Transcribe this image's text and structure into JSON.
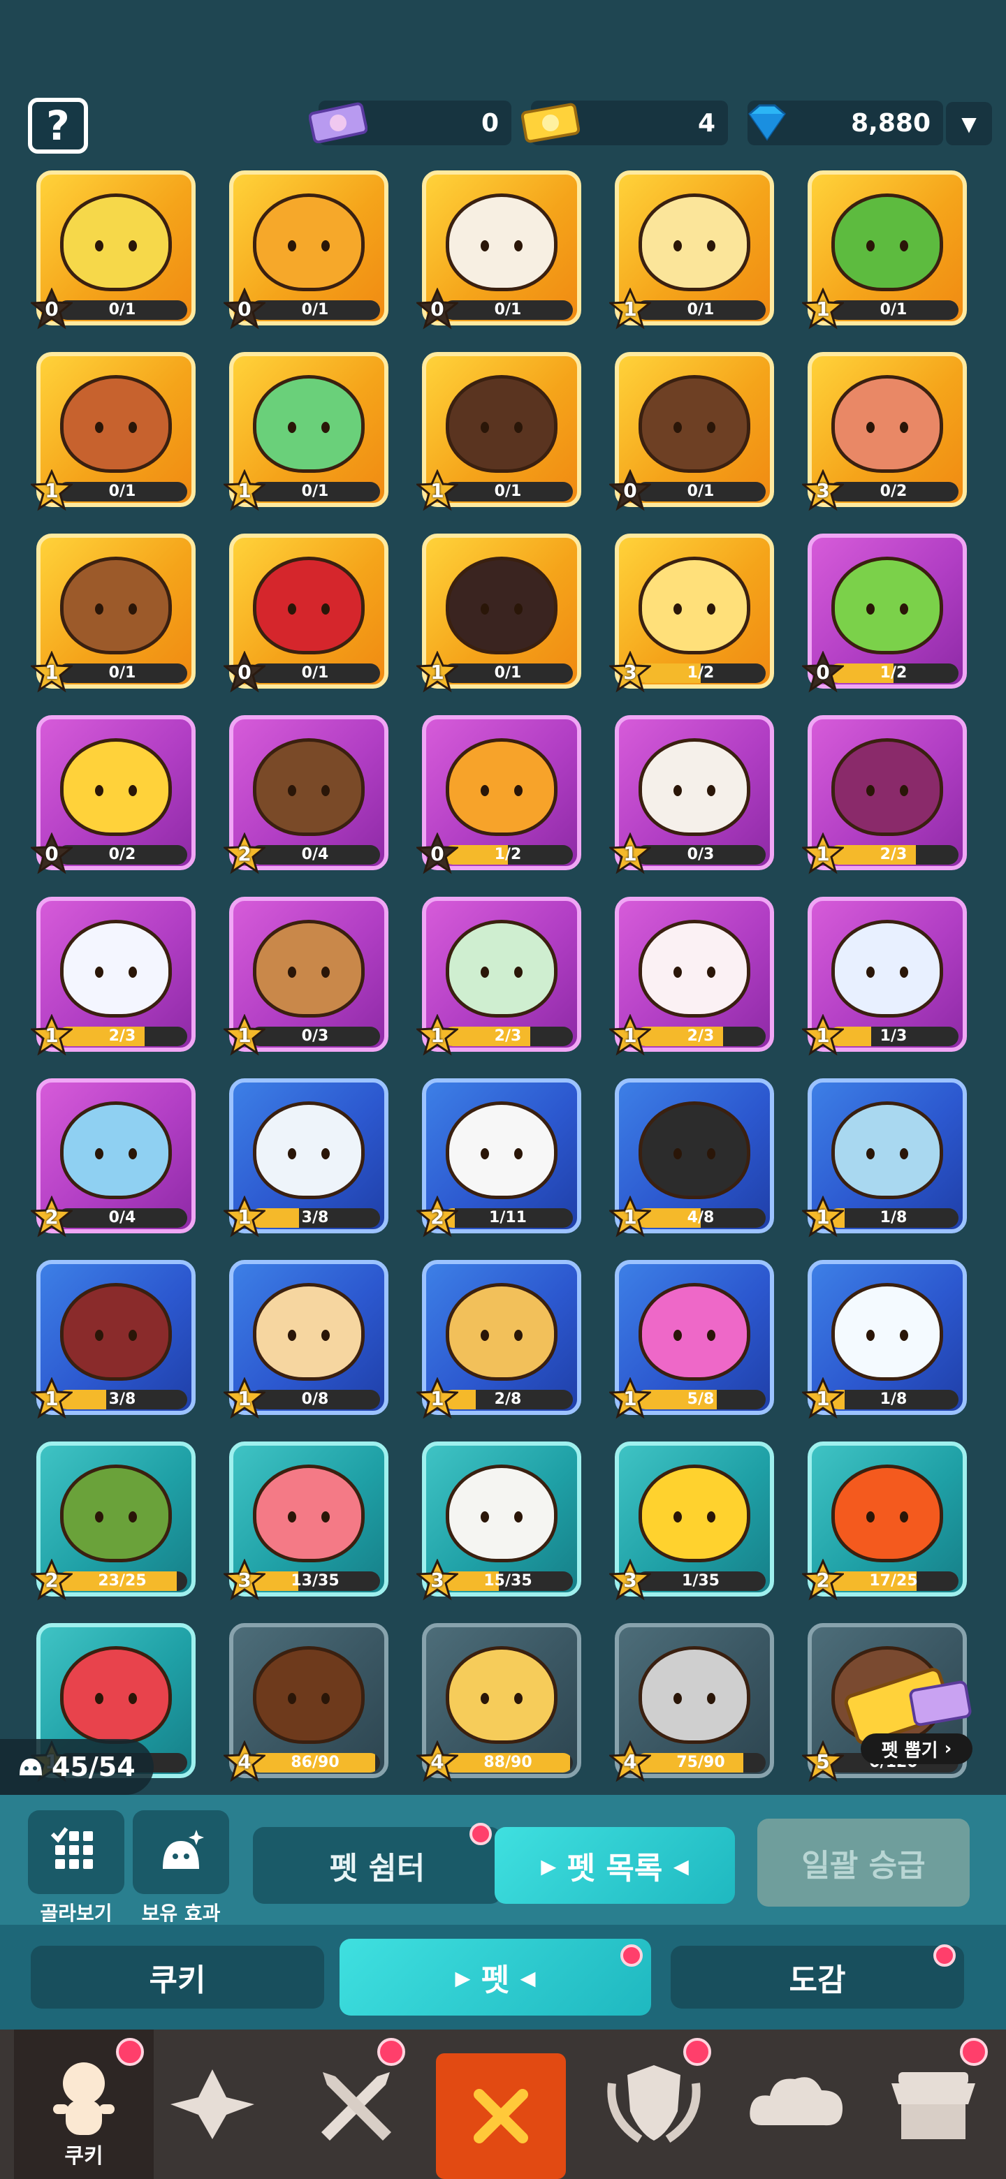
{
  "top": {
    "ticket_pink": "0",
    "ticket_gold": "4",
    "gems": "8,880",
    "help": "?"
  },
  "pets": [
    {
      "rarity": "g",
      "level": "0",
      "progress": "0/1",
      "fill": 0.0,
      "color": "#f6d84a"
    },
    {
      "rarity": "g",
      "level": "0",
      "progress": "0/1",
      "fill": 0.0,
      "color": "#f6a82a"
    },
    {
      "rarity": "g",
      "level": "0",
      "progress": "0/1",
      "fill": 0.0,
      "color": "#f7efe2"
    },
    {
      "rarity": "g",
      "level": "1",
      "progress": "0/1",
      "fill": 0.0,
      "color": "#fbe59a"
    },
    {
      "rarity": "g",
      "level": "1",
      "progress": "0/1",
      "fill": 0.0,
      "color": "#5dbb3f"
    },
    {
      "rarity": "g",
      "level": "1",
      "progress": "0/1",
      "fill": 0.0,
      "color": "#c7622e"
    },
    {
      "rarity": "g",
      "level": "1",
      "progress": "0/1",
      "fill": 0.0,
      "color": "#6ad07a"
    },
    {
      "rarity": "g",
      "level": "1",
      "progress": "0/1",
      "fill": 0.0,
      "color": "#5a3420"
    },
    {
      "rarity": "g",
      "level": "0",
      "progress": "0/1",
      "fill": 0.0,
      "color": "#6e4024"
    },
    {
      "rarity": "g",
      "level": "3",
      "progress": "0/2",
      "fill": 0.0,
      "color": "#e98866"
    },
    {
      "rarity": "g",
      "level": "1",
      "progress": "0/1",
      "fill": 0.0,
      "color": "#9c5a2a"
    },
    {
      "rarity": "g",
      "level": "0",
      "progress": "0/1",
      "fill": 0.0,
      "color": "#d5262c"
    },
    {
      "rarity": "g",
      "level": "1",
      "progress": "0/1",
      "fill": 0.0,
      "color": "#3a2420"
    },
    {
      "rarity": "g",
      "level": "3",
      "progress": "1/2",
      "fill": 0.5,
      "color": "#ffe07a"
    },
    {
      "rarity": "p",
      "level": "0",
      "progress": "1/2",
      "fill": 0.5,
      "color": "#7bd14a"
    },
    {
      "rarity": "p",
      "level": "0",
      "progress": "0/2",
      "fill": 0.0,
      "color": "#ffd23a"
    },
    {
      "rarity": "p",
      "level": "2",
      "progress": "0/4",
      "fill": 0.0,
      "color": "#7a4a28"
    },
    {
      "rarity": "p",
      "level": "0",
      "progress": "1/2",
      "fill": 0.5,
      "color": "#f7a32a"
    },
    {
      "rarity": "p",
      "level": "1",
      "progress": "0/3",
      "fill": 0.0,
      "color": "#f5f0ea"
    },
    {
      "rarity": "p",
      "level": "1",
      "progress": "2/3",
      "fill": 0.67,
      "color": "#8a2a6a"
    },
    {
      "rarity": "p",
      "level": "1",
      "progress": "2/3",
      "fill": 0.67,
      "color": "#f4f6ff"
    },
    {
      "rarity": "p",
      "level": "1",
      "progress": "0/3",
      "fill": 0.0,
      "color": "#c9884a"
    },
    {
      "rarity": "p",
      "level": "1",
      "progress": "2/3",
      "fill": 0.67,
      "color": "#cfeed0"
    },
    {
      "rarity": "p",
      "level": "1",
      "progress": "2/3",
      "fill": 0.67,
      "color": "#fbf1f4"
    },
    {
      "rarity": "p",
      "level": "1",
      "progress": "1/3",
      "fill": 0.33,
      "color": "#e8f0ff"
    },
    {
      "rarity": "p",
      "level": "2",
      "progress": "0/4",
      "fill": 0.0,
      "color": "#8fd0f2"
    },
    {
      "rarity": "b",
      "level": "1",
      "progress": "3/8",
      "fill": 0.375,
      "color": "#eef4fa"
    },
    {
      "rarity": "b",
      "level": "2",
      "progress": "1/11",
      "fill": 0.09,
      "color": "#f7f7f7"
    },
    {
      "rarity": "b",
      "level": "1",
      "progress": "4/8",
      "fill": 0.5,
      "color": "#2c2c2c"
    },
    {
      "rarity": "b",
      "level": "1",
      "progress": "1/8",
      "fill": 0.125,
      "color": "#a9d8f0"
    },
    {
      "rarity": "b",
      "level": "1",
      "progress": "3/8",
      "fill": 0.375,
      "color": "#8a2b2b"
    },
    {
      "rarity": "b",
      "level": "1",
      "progress": "0/8",
      "fill": 0.0,
      "color": "#f6d6a0"
    },
    {
      "rarity": "b",
      "level": "1",
      "progress": "2/8",
      "fill": 0.25,
      "color": "#f2c05a"
    },
    {
      "rarity": "b",
      "level": "1",
      "progress": "5/8",
      "fill": 0.625,
      "color": "#ee68c8"
    },
    {
      "rarity": "b",
      "level": "1",
      "progress": "1/8",
      "fill": 0.125,
      "color": "#f4faff"
    },
    {
      "rarity": "t",
      "level": "2",
      "progress": "23/25",
      "fill": 0.92,
      "color": "#6aa23a"
    },
    {
      "rarity": "t",
      "level": "3",
      "progress": "13/35",
      "fill": 0.37,
      "color": "#f47a86"
    },
    {
      "rarity": "t",
      "level": "3",
      "progress": "15/35",
      "fill": 0.43,
      "color": "#f5f5f2"
    },
    {
      "rarity": "t",
      "level": "3",
      "progress": "1/35",
      "fill": 0.03,
      "color": "#ffd22e"
    },
    {
      "rarity": "t",
      "level": "2",
      "progress": "17/25",
      "fill": 0.68,
      "color": "#f45a1e"
    },
    {
      "rarity": "t",
      "level": "1",
      "progress": "",
      "fill": 0.0,
      "color": "#e8434c"
    },
    {
      "rarity": "d",
      "level": "4",
      "progress": "86/90",
      "fill": 0.96,
      "color": "#6e3a1c"
    },
    {
      "rarity": "d",
      "level": "4",
      "progress": "88/90",
      "fill": 0.98,
      "color": "#f6cc5a"
    },
    {
      "rarity": "d",
      "level": "4",
      "progress": "75/90",
      "fill": 0.83,
      "color": "#cfcfcf"
    },
    {
      "rarity": "d",
      "level": "5",
      "progress": "0/120",
      "fill": 0.0,
      "color": "#7a4a30"
    }
  ],
  "collection_count": "45/54",
  "gacha_label": "펫 뽑기",
  "actions": {
    "view": "골라보기",
    "effect": "보유 효과",
    "shelter": "펫 쉼터",
    "list": "펫 목록",
    "bulk": "일괄 승급"
  },
  "subtabs": {
    "cookie": "쿠키",
    "pet": "펫",
    "codex": "도감"
  },
  "nav": {
    "cookie": "쿠키"
  },
  "colors": {
    "panel": "#2a7f8f",
    "accent": "#27c6c9",
    "badge": "#ff3f6b"
  }
}
